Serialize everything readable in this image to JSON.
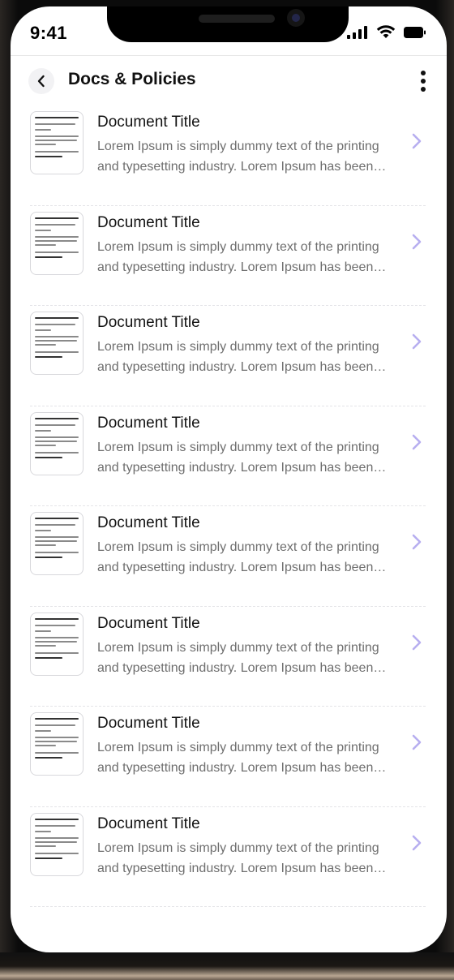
{
  "status_bar": {
    "time": "9:41"
  },
  "header": {
    "title": "Docs & Policies"
  },
  "icons": {
    "back": "chevron-left-icon",
    "more": "more-vertical-icon",
    "chevron": "chevron-right-icon",
    "signal": "cellular-signal-icon",
    "wifi": "wifi-icon",
    "battery": "battery-icon"
  },
  "colors": {
    "accent": "#b7aef0",
    "title": "#111111",
    "desc": "#6e6e6e"
  },
  "documents": [
    {
      "title": "Document Title",
      "description": "Lorem Ipsum is simply dummy text of the printing and typesetting industry. Lorem Ipsum has been the industry's standard dummy text"
    },
    {
      "title": "Document Title",
      "description": "Lorem Ipsum is simply dummy text of the printing and typesetting industry. Lorem Ipsum has been the industry's standard dummy text"
    },
    {
      "title": "Document Title",
      "description": "Lorem Ipsum is simply dummy text of the printing and typesetting industry. Lorem Ipsum has been the industry's standard dummy text"
    },
    {
      "title": "Document Title",
      "description": "Lorem Ipsum is simply dummy text of the printing and typesetting industry. Lorem Ipsum has been the industry's standard dummy text"
    },
    {
      "title": "Document Title",
      "description": "Lorem Ipsum is simply dummy text of the printing and typesetting industry. Lorem Ipsum has been the industry's standard dummy text"
    },
    {
      "title": "Document Title",
      "description": "Lorem Ipsum is simply dummy text of the printing and typesetting industry. Lorem Ipsum has been the industry's standard dummy text"
    },
    {
      "title": "Document Title",
      "description": "Lorem Ipsum is simply dummy text of the printing and typesetting industry. Lorem Ipsum has been the industry's standard dummy text"
    },
    {
      "title": "Document Title",
      "description": "Lorem Ipsum is simply dummy text of the printing and typesetting industry. Lorem Ipsum has been the industry's standard dummy text"
    }
  ]
}
